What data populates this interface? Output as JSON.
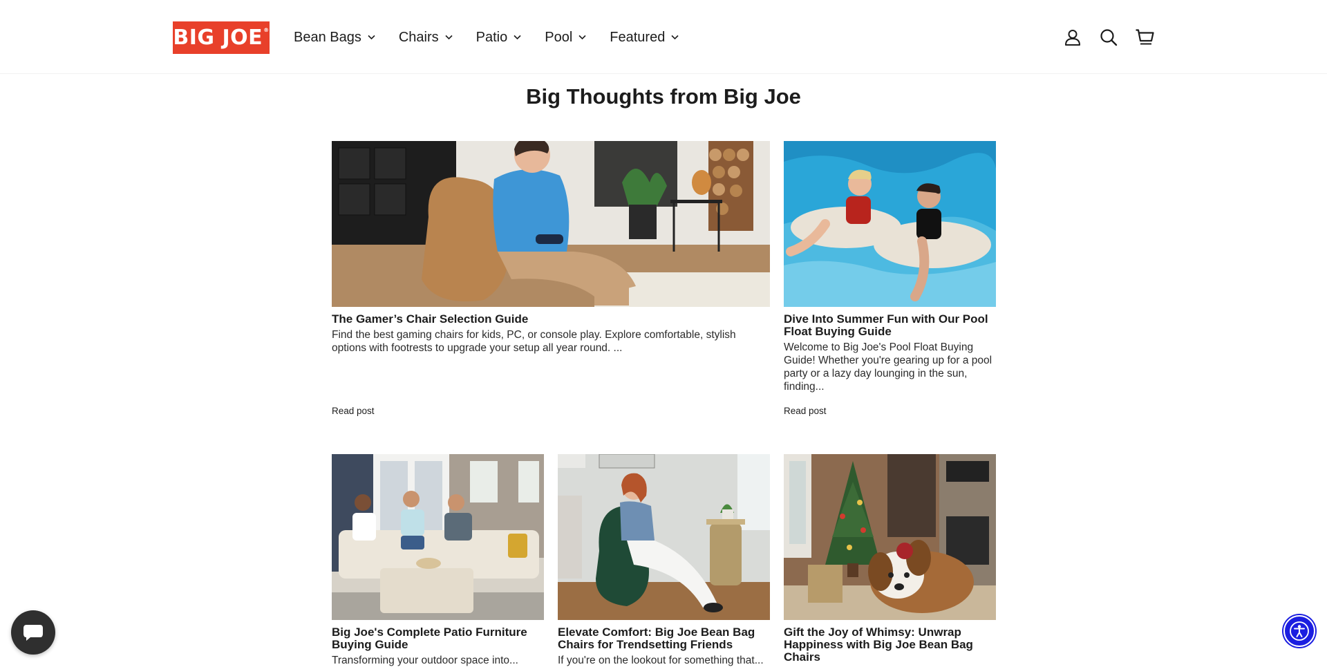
{
  "brand": {
    "logo_text": "BIG JOE",
    "logo_mark": "®",
    "brand_color": "#e8402a"
  },
  "nav": {
    "items": [
      {
        "label": "Bean Bags"
      },
      {
        "label": "Chairs"
      },
      {
        "label": "Patio"
      },
      {
        "label": "Pool"
      },
      {
        "label": "Featured"
      }
    ]
  },
  "header_icons": [
    "account-icon",
    "search-icon",
    "cart-icon"
  ],
  "page_title": "Big Thoughts from Big Joe",
  "posts": [
    {
      "title": "The Gamer’s Chair Selection Guide",
      "excerpt": "Find the best gaming chairs for kids, PC, or console play. Explore comfortable, stylish options with footrests to upgrade your setup all year round. ...",
      "link": "Read post"
    },
    {
      "title": "Dive Into Summer Fun with Our Pool Float Buying Guide",
      "excerpt": "Welcome to Big Joe's Pool Float Buying Guide! Whether you're gearing up for a pool party or a lazy day lounging in the sun, finding...",
      "link": "Read post"
    },
    {
      "title": "Big Joe's Complete Patio Furniture Buying Guide",
      "excerpt": "Transforming your outdoor space into..."
    },
    {
      "title": "Elevate Comfort: Big Joe Bean Bag Chairs for Trendsetting Friends",
      "excerpt": "If you're on the lookout for something that..."
    },
    {
      "title": "Gift the Joy of Whimsy: Unwrap Happiness with Big Joe Bean Bag Chairs",
      "excerpt": ""
    }
  ],
  "widgets": {
    "chat": "chat-icon",
    "accessibility": "accessibility-icon"
  },
  "colors": {
    "text": "#1c1c1c",
    "accessibility_blue": "#1b1ee0",
    "chat_dark": "#2f2f2f"
  }
}
